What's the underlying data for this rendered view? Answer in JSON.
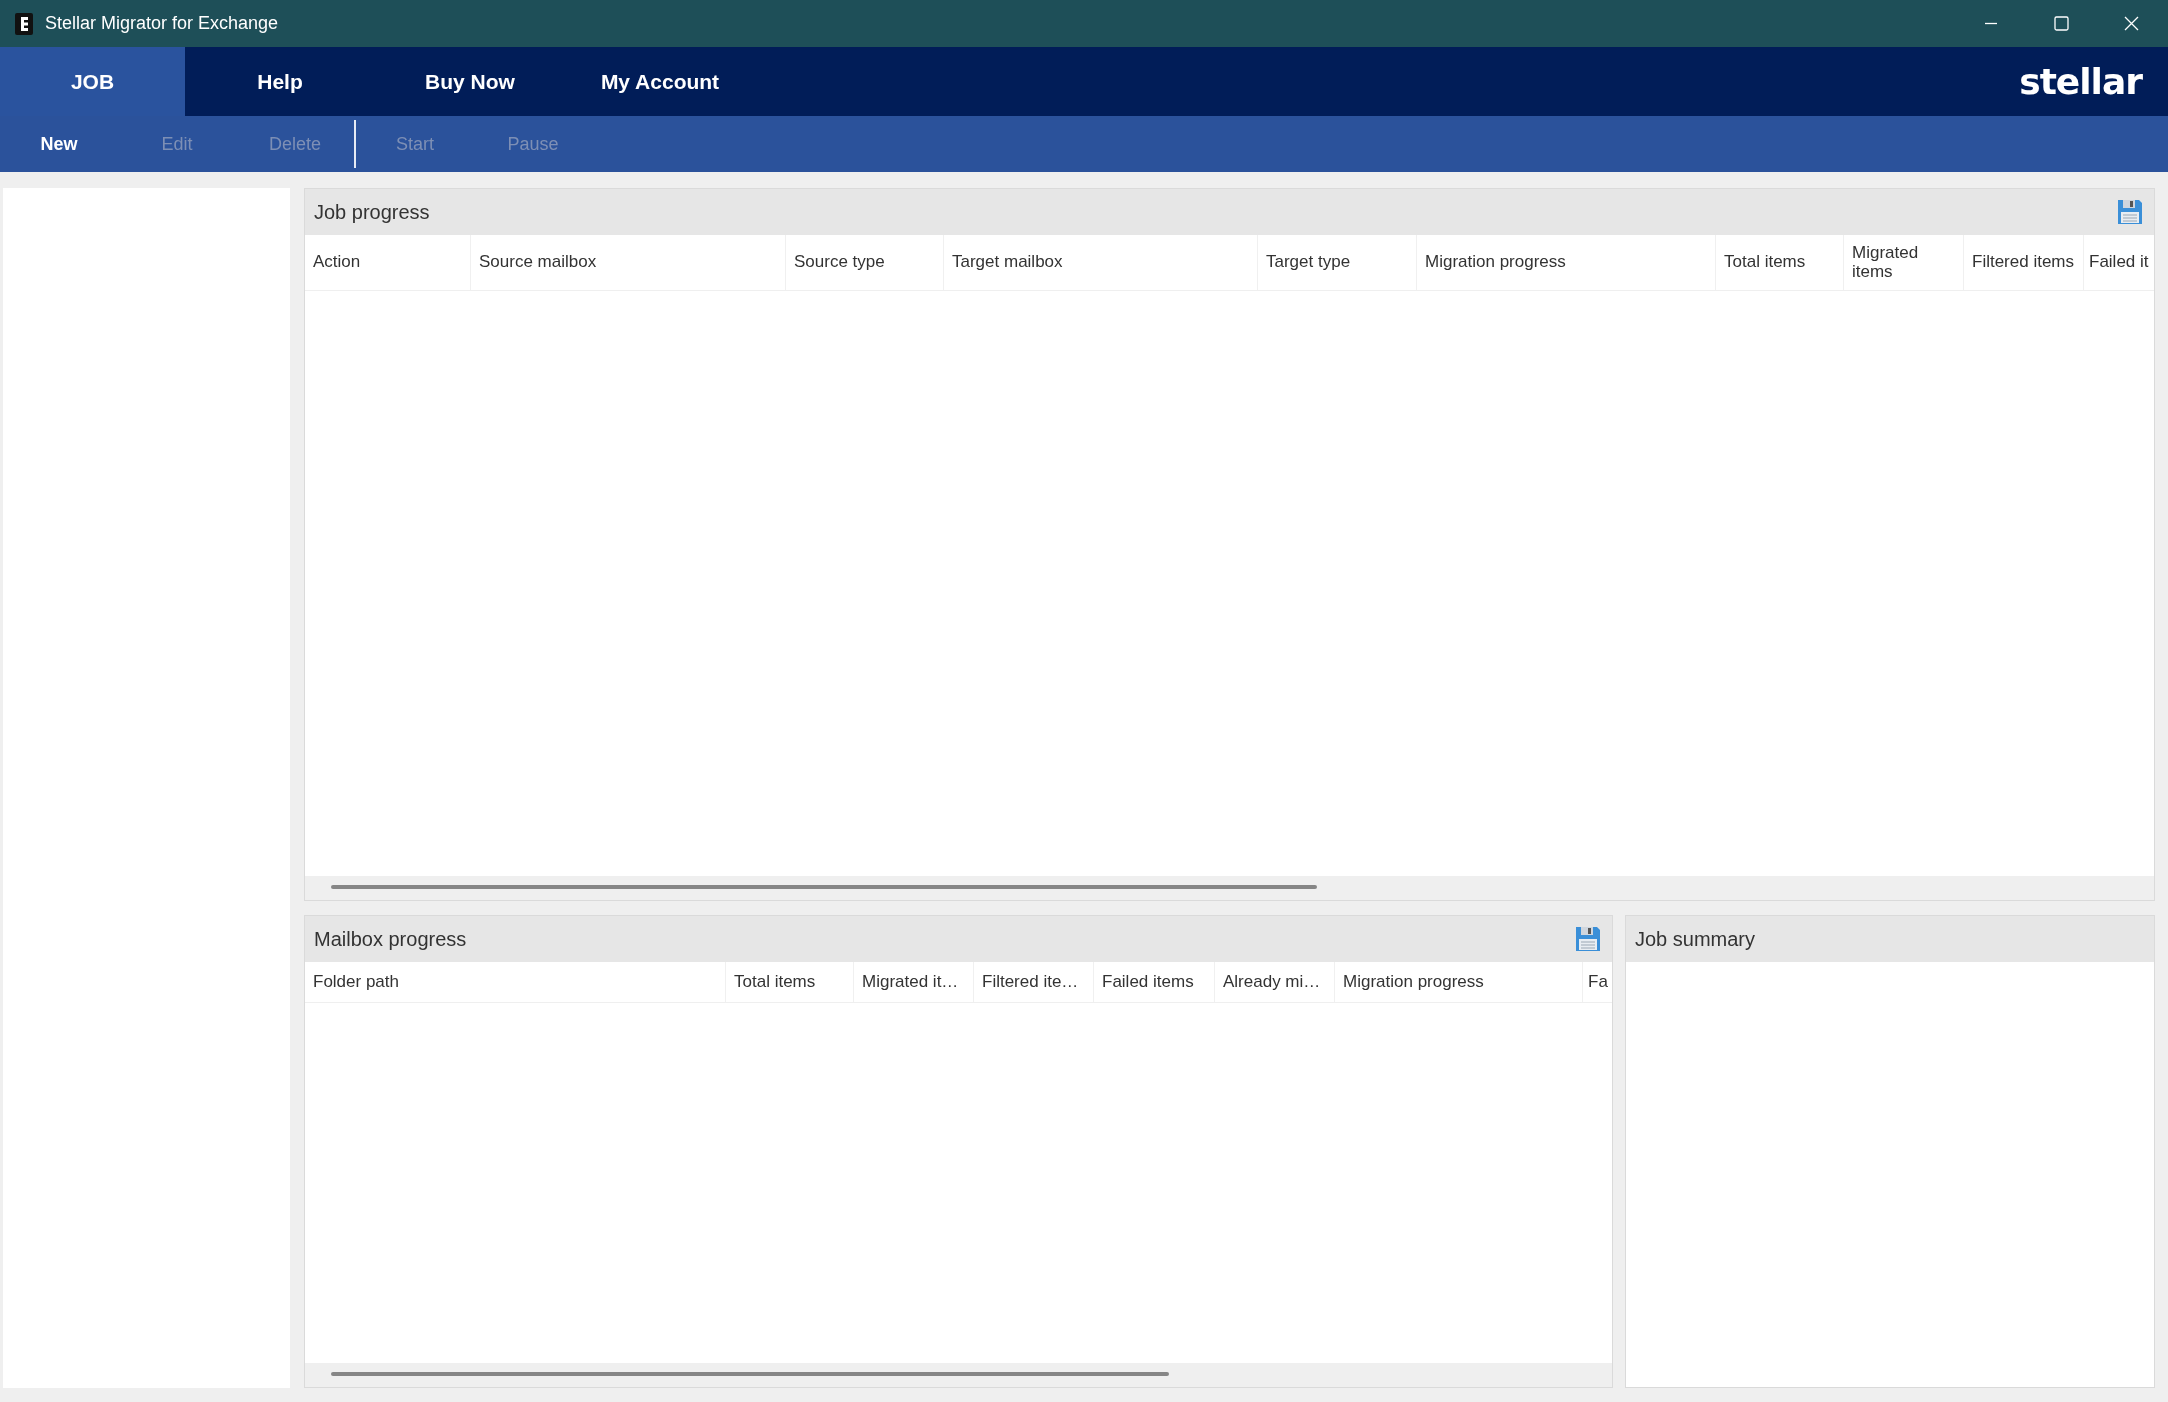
{
  "window": {
    "title": "Stellar Migrator for Exchange"
  },
  "menu": {
    "tabs": [
      {
        "label": "JOB",
        "selected": true
      },
      {
        "label": "Help",
        "selected": false
      },
      {
        "label": "Buy Now",
        "selected": false
      },
      {
        "label": "My Account",
        "selected": false
      }
    ],
    "logo": "stellar"
  },
  "toolbar": {
    "groups": [
      [
        {
          "label": "New",
          "disabled": false
        },
        {
          "label": "Edit",
          "disabled": true
        },
        {
          "label": "Delete",
          "disabled": true
        }
      ],
      [
        {
          "label": "Start",
          "disabled": true
        },
        {
          "label": "Pause",
          "disabled": true
        }
      ]
    ]
  },
  "job_progress": {
    "title": "Job progress",
    "columns": [
      "Action",
      "Source mailbox",
      "Source type",
      "Target mailbox",
      "Target type",
      "Migration progress",
      "Total items",
      "Migrated items",
      "Filtered items",
      "Failed it"
    ]
  },
  "mailbox_progress": {
    "title": "Mailbox progress",
    "columns": [
      "Folder path",
      "Total items",
      "Migrated it…",
      "Filtered ite…",
      "Failed items",
      "Already mi…",
      "Migration progress",
      "Fa"
    ]
  },
  "job_summary": {
    "title": "Job summary"
  }
}
